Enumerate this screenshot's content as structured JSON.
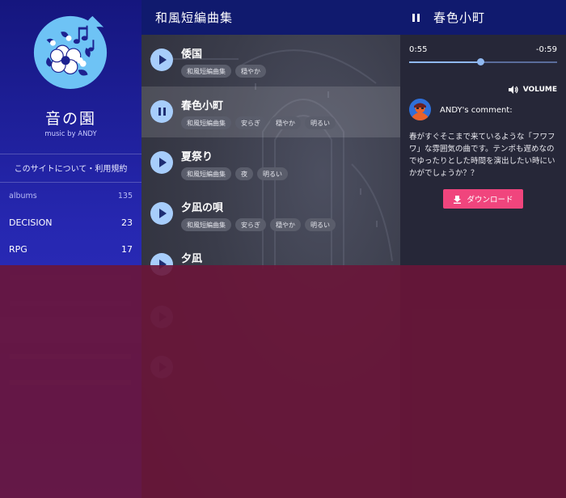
{
  "sidebar": {
    "title": "音の園",
    "subtitle": "music by ANDY",
    "about_link": "このサイトについて・利用規約",
    "header": {
      "label": "albums",
      "count": "135"
    },
    "albums": [
      {
        "label": "DECISION",
        "count": "23"
      },
      {
        "label": "RPG",
        "count": "17"
      }
    ]
  },
  "main": {
    "title": "和風短編曲集",
    "tracks": [
      {
        "title": "倭国",
        "tags": [
          "和風短編曲集",
          "穏やか"
        ],
        "playing": false
      },
      {
        "title": "春色小町",
        "tags": [
          "和風短編曲集",
          "安らぎ",
          "穏やか",
          "明るい"
        ],
        "playing": true
      },
      {
        "title": "夏祭り",
        "tags": [
          "和風短編曲集",
          "夜",
          "明るい"
        ],
        "playing": false
      },
      {
        "title": "夕凪の唄",
        "tags": [
          "和風短編曲集",
          "安らぎ",
          "穏やか",
          "明るい"
        ],
        "playing": false
      },
      {
        "title": "夕凪",
        "tags": [],
        "playing": false
      }
    ]
  },
  "player": {
    "title": "春色小町",
    "time_current": "0:55",
    "time_remaining": "-0:59",
    "progress": 0.48,
    "volume_label": "VOLUME",
    "commenter": "ANDY's comment:",
    "comment": "春がすぐそこまで来ているような「フワフワ」な雰囲気の曲です。テンポも遅めなのでゆったりとした時間を演出したい時にいかがでしょうか？？",
    "download_label": "ダウンロード"
  },
  "colors": {
    "accent": "#f0457d",
    "play_button": "#a7cdfb",
    "header": "#101a6e",
    "overlay": "#6a1538"
  }
}
